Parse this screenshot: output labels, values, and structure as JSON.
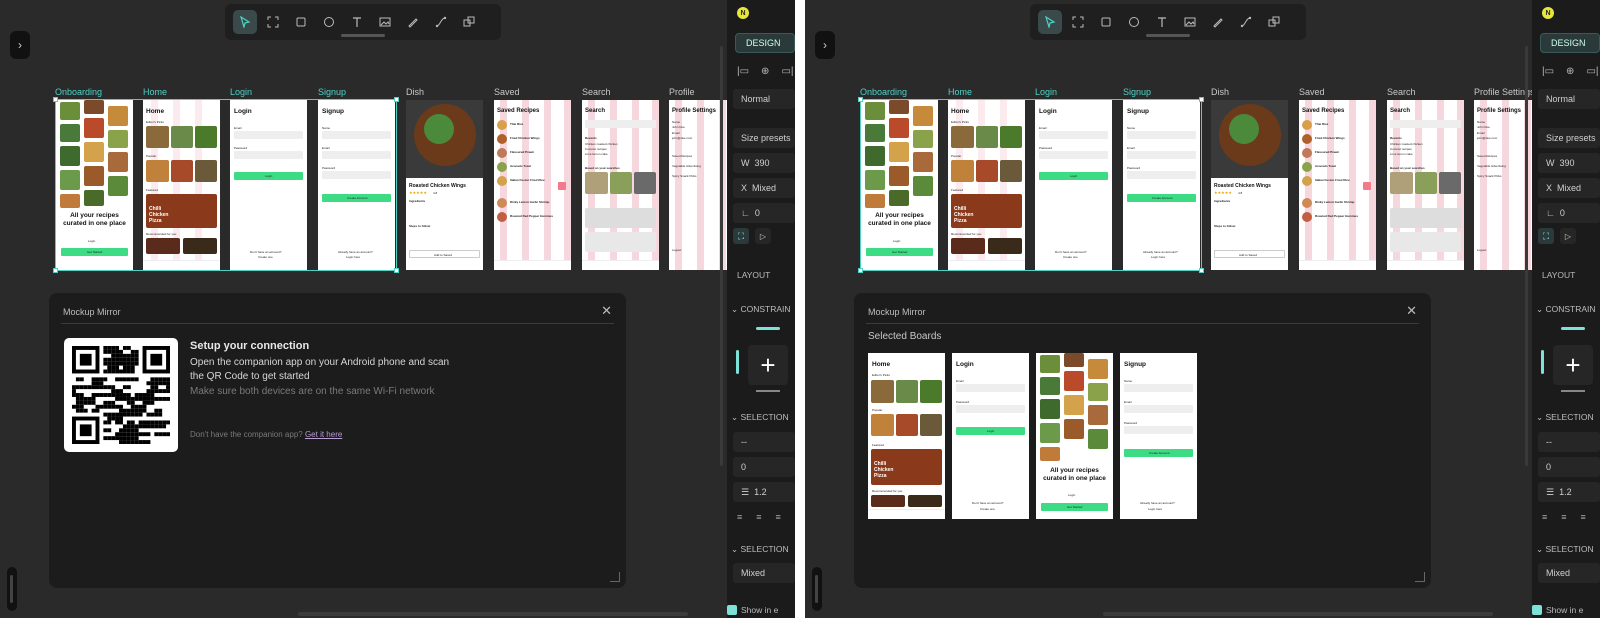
{
  "colors": {
    "accent": "#4fd1c5",
    "canvas": "#2a2a2a",
    "panel": "#1c1c1c",
    "green": "#3ddc84",
    "pink": "#f7d7de",
    "link": "#b99cd4"
  },
  "toolbar": {
    "tools": [
      "pointer-icon",
      "frame-icon",
      "rectangle-icon",
      "ellipse-icon",
      "text-icon",
      "image-icon",
      "pen-icon",
      "connector-icon",
      "component-icon"
    ]
  },
  "boards": [
    "Onboarding",
    "Home",
    "Login",
    "Signup",
    "Dish",
    "Saved",
    "Search",
    "Profile",
    "Profile Settings"
  ],
  "mockups": {
    "onboarding": {
      "tagline": "All your recipes curated in one place",
      "login": "Login",
      "get_started": "Get Started"
    },
    "home": {
      "title": "Home",
      "editors": "Editor's Picks",
      "popular": "Popular",
      "featured": "Featured",
      "featured_dish": "Chilli Chicken Pizza",
      "recommended": "Recommended for you"
    },
    "login": {
      "title": "Login",
      "email": "Email",
      "password": "Password",
      "button": "Login",
      "footer1": "Don't have an account?",
      "footer2": "Create one"
    },
    "signup": {
      "title": "Signup",
      "name": "Name",
      "email": "Email",
      "password": "Password",
      "button": "Create Account",
      "footer1": "Already have an account?",
      "footer2": "Login here"
    },
    "dish": {
      "title": "Roasted Chicken Wings",
      "rating": "4.8",
      "ingredients": "Ingredients",
      "steps": "Steps to follow",
      "add": "Add to Saved"
    },
    "saved": {
      "title": "Saved Recipes",
      "items": [
        "Thai Rice",
        "Fried Chicken Wings",
        "Flavoured Prawn",
        "Avocado Toast",
        "Italian Fusion Fried Rice",
        "Dinky Lemon Garlic Shrimp",
        "Roasted Red Pepper Hummus"
      ]
    },
    "search": {
      "title": "Search",
      "recents": "Recents",
      "r1": "Chicken roasted chicken",
      "r2": "Coconut recipes",
      "r3": "Lime lemon cake",
      "based": "Based on your searches"
    },
    "profile": {
      "title": "Profile Settings",
      "name": "Name",
      "name_val": "John Doe",
      "email": "Email",
      "email_val": "john@doe.com",
      "menu": [
        "Saved Recipes",
        "Vegetable Advertising",
        "Spicy Snack Picks"
      ],
      "logout": "Logout"
    }
  },
  "mirror": {
    "title": "Mockup Mirror",
    "heading": "Setup your connection",
    "desc": "Open the companion app on your Android phone and scan the QR Code to get started",
    "sub": "Make sure both devices are on the same Wi-Fi network",
    "no_app": "Don't have the companion app?",
    "get_it": "Get it here",
    "selected": "Selected Boards"
  },
  "design_panel": {
    "avatar": "N",
    "tab": "DESIGN",
    "blend": "Normal",
    "size_presets": "Size presets",
    "w_label": "W",
    "w_value": "390",
    "x_label": "X",
    "x_value": "Mixed",
    "corner_value": "0",
    "layout": "LAYOUT",
    "constraints": "CONSTRAIN",
    "selection": "SELECTION",
    "selection2": "SELECTION",
    "field_dash": "--",
    "field_zero": "0",
    "line_height": "1.2",
    "mixed": "Mixed",
    "show": "Show in e"
  }
}
